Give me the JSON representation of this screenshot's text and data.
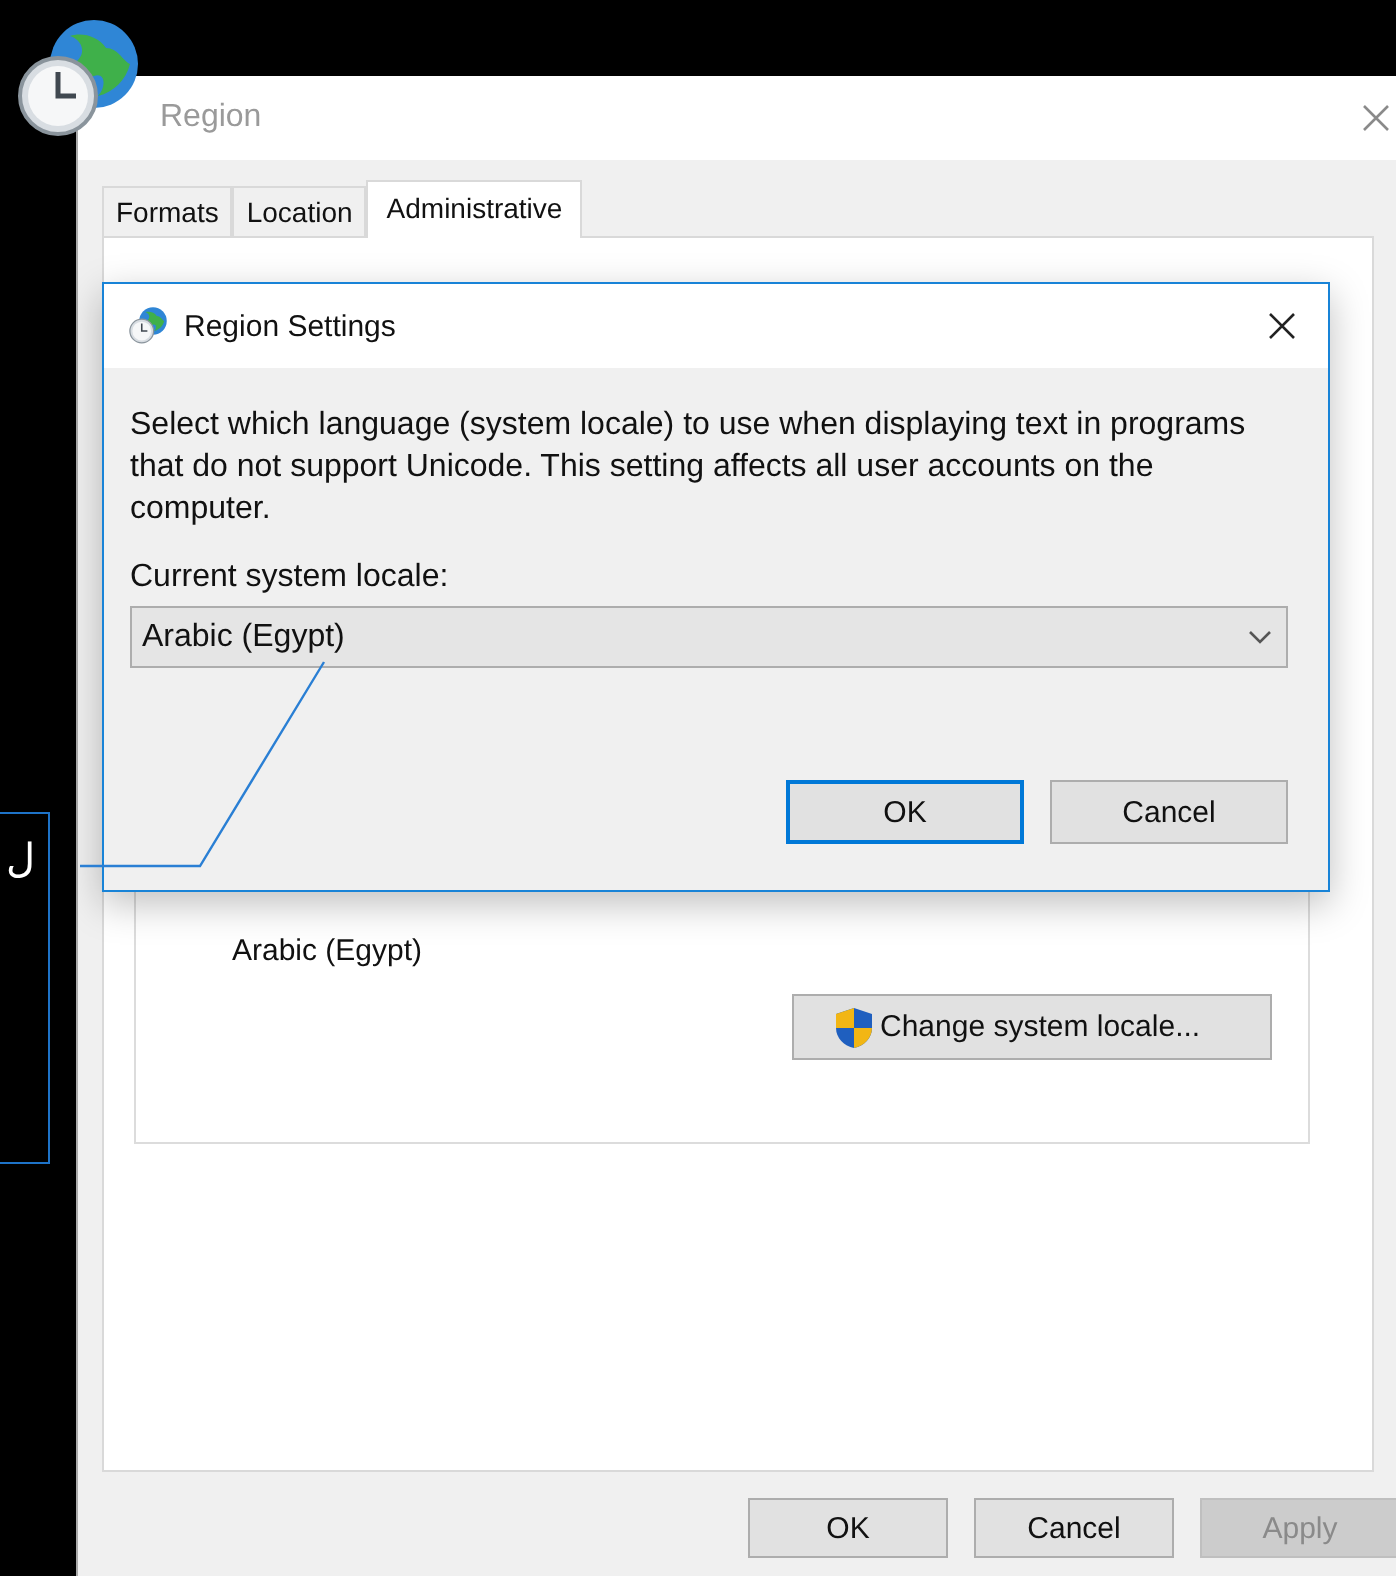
{
  "callout": {
    "text": "ل"
  },
  "region_window": {
    "title": "Region",
    "tabs": [
      {
        "label": "Formats",
        "selected": false
      },
      {
        "label": "Location",
        "selected": false
      },
      {
        "label": "Administrative",
        "selected": true
      }
    ],
    "group": {
      "value": "Arabic (Egypt)",
      "button": "Change system locale..."
    },
    "buttons": [
      {
        "label": "OK",
        "disabled": false
      },
      {
        "label": "Cancel",
        "disabled": false
      },
      {
        "label": "Apply",
        "disabled": true
      }
    ]
  },
  "dialog": {
    "title": "Region Settings",
    "description": "Select which language (system locale) to use when displaying text in programs that do not support Unicode. This setting affects all user accounts on the computer.",
    "locale_label": "Current system locale:",
    "locale_value": "Arabic (Egypt)",
    "buttons": [
      {
        "label": "OK",
        "default": true
      },
      {
        "label": "Cancel",
        "default": false
      }
    ]
  }
}
